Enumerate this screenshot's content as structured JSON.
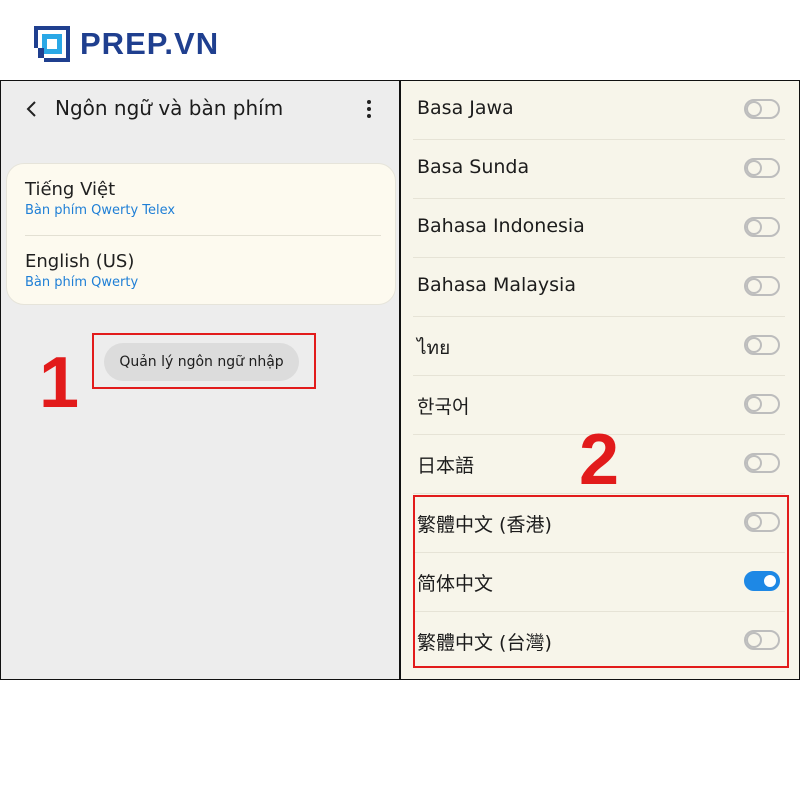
{
  "brand": {
    "name": "PREP.VN",
    "color": "#1f3f8f"
  },
  "left_screen": {
    "title": "Ngôn ngữ và bàn phím",
    "back_icon": "chevron-left-icon",
    "more_icon": "more-vertical-icon",
    "keyboards": [
      {
        "name": "Tiếng Việt",
        "subtitle": "Bàn phím Qwerty Telex"
      },
      {
        "name": "English (US)",
        "subtitle": "Bàn phím Qwerty"
      }
    ],
    "manage_button": "Quản lý ngôn ngữ nhập",
    "step_label": "1"
  },
  "right_screen": {
    "languages": [
      {
        "label": "Basa Jawa",
        "enabled": false
      },
      {
        "label": "Basa Sunda",
        "enabled": false
      },
      {
        "label": "Bahasa Indonesia",
        "enabled": false
      },
      {
        "label": "Bahasa Malaysia",
        "enabled": false
      },
      {
        "label": "ไทย",
        "enabled": false
      },
      {
        "label": "한국어",
        "enabled": false
      },
      {
        "label": "日本語",
        "enabled": false
      },
      {
        "label": "繁體中文 (香港)",
        "enabled": false
      },
      {
        "label": "简体中文",
        "enabled": true
      },
      {
        "label": "繁體中文 (台灣)",
        "enabled": false
      }
    ],
    "step_label": "2"
  },
  "colors": {
    "highlight": "#e21b1b",
    "accent": "#1e88e5",
    "subtitle": "#1f7fd6"
  }
}
